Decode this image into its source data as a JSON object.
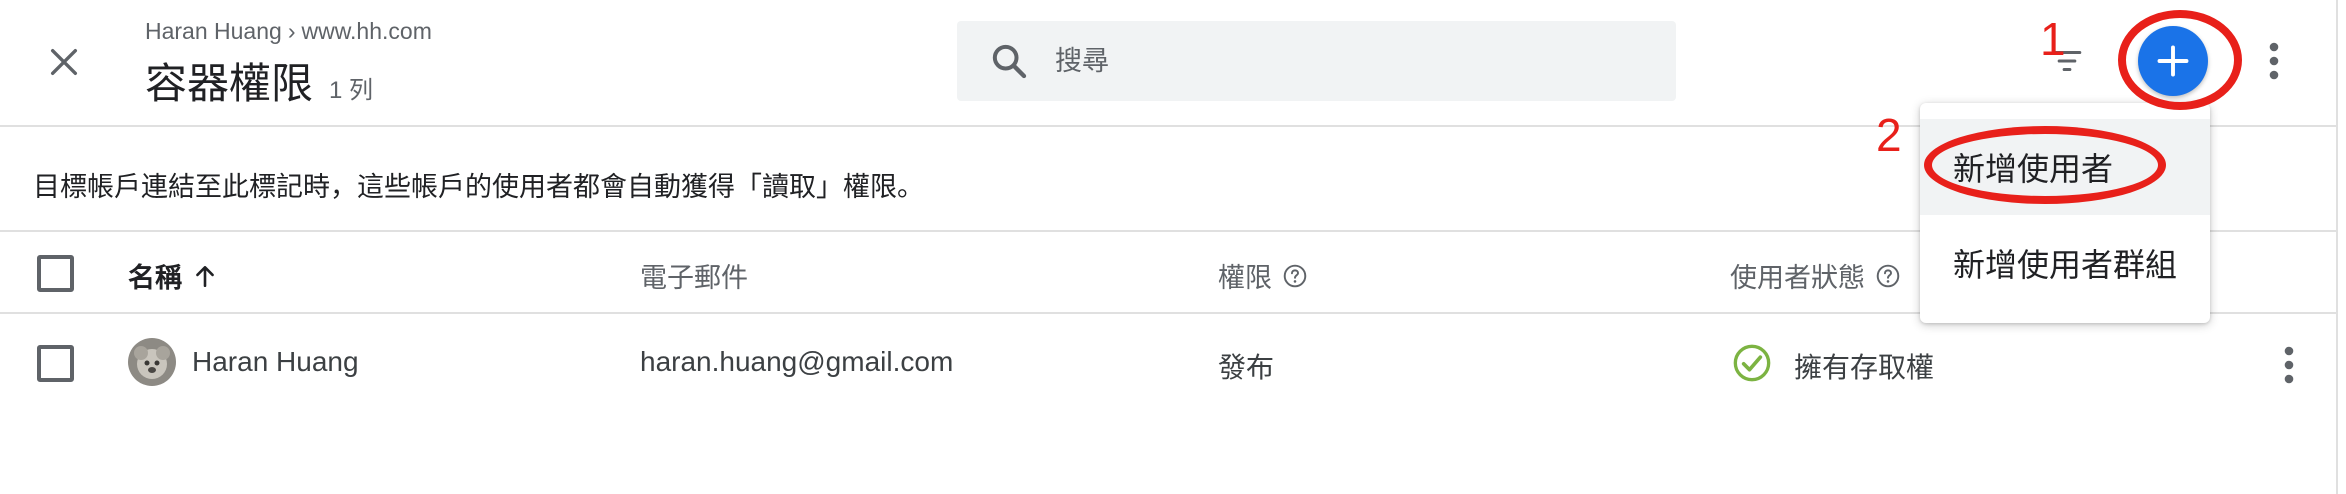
{
  "header": {
    "breadcrumb_user": "Haran Huang",
    "breadcrumb_sep": "›",
    "breadcrumb_site": "www.hh.com",
    "title": "容器權限",
    "count": "1 列"
  },
  "search": {
    "placeholder": "搜尋",
    "value": ""
  },
  "info": {
    "text": "目標帳戶連結至此標記時，這些帳戶的使用者都會自動獲得「讀取」權限。"
  },
  "table": {
    "columns": [
      {
        "label": "名稱",
        "sort": "ascending"
      },
      {
        "label": "電子郵件"
      },
      {
        "label": "權限"
      },
      {
        "label": "使用者狀態"
      }
    ],
    "rows": [
      {
        "name": "Haran Huang",
        "email": "haran.huang@gmail.com",
        "permission": "發布",
        "status": "擁有存取權"
      }
    ]
  },
  "menu": {
    "items": [
      {
        "label": "新增使用者"
      },
      {
        "label": "新增使用者群組"
      }
    ]
  },
  "annotations": {
    "step1": "1",
    "step2": "2"
  },
  "icons": {
    "close": "close-icon",
    "search": "search-icon",
    "filter": "filter-icon",
    "add": "plus-icon",
    "more": "more-vert-icon",
    "sort": "arrow-up-icon",
    "help": "help-circle-icon",
    "status": "check-circle-icon"
  },
  "colors": {
    "accent": "#1a73e8",
    "annotation": "#e8201a",
    "status_ok": "#7cb342"
  }
}
